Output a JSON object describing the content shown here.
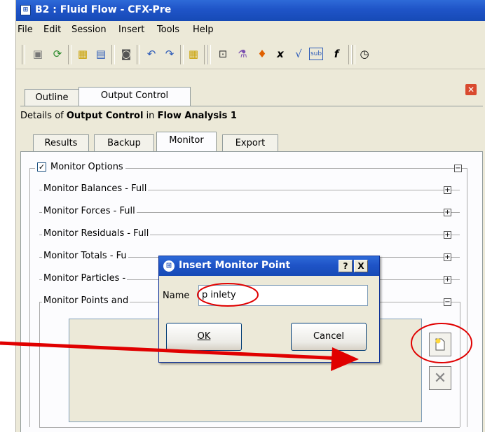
{
  "window": {
    "title": "B2 : Fluid Flow - CFX-Pre"
  },
  "menu": [
    "File",
    "Edit",
    "Session",
    "Insert",
    "Tools",
    "Help"
  ],
  "toolbar_icons": [
    "save-icon",
    "refresh-icon",
    "import-mesh-icon",
    "mesh-icon",
    "camera-icon",
    "undo-icon",
    "redo-icon",
    "import-icon",
    "domain-icon",
    "flask-icon",
    "flame-icon",
    "expression-icon",
    "function-icon",
    "sub-icon",
    "fx-icon",
    "clock-icon"
  ],
  "tabs": {
    "outline": "Outline",
    "output_control": "Output Control"
  },
  "details": {
    "prefix": "Details of ",
    "object": "Output Control",
    "middle": " in ",
    "parent": "Flow Analysis 1"
  },
  "subtabs": [
    "Results",
    "Backup",
    "Monitor",
    "Export"
  ],
  "monitor": {
    "options_label": "Monitor Options",
    "options_checked": true,
    "sections": [
      "Monitor Balances - Full",
      "Monitor Forces - Full",
      "Monitor Residuals - Full",
      "Monitor Totals - Fu",
      "Monitor Particles -",
      "Monitor Points and"
    ]
  },
  "dialog": {
    "title": "Insert Monitor Point",
    "help": "?",
    "close": "X",
    "name_label": "Name",
    "name_value": "p inlety",
    "ok": "OK",
    "cancel": "Cancel"
  },
  "colors": {
    "annotation": "#e00000",
    "titlebar": "#1f54c7"
  }
}
